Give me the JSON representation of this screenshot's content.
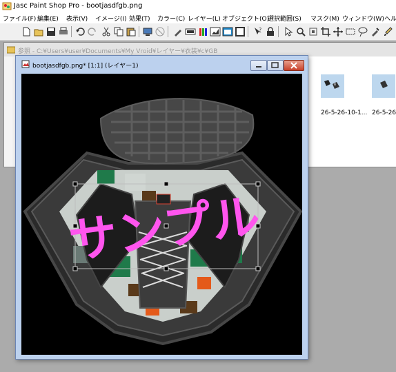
{
  "app": {
    "title": "Jasc Paint Shop Pro - bootjasdfgb.png"
  },
  "menu": [
    "ファイル(F)",
    "編集(E)",
    "表示(V)",
    "イメージ(I)",
    "効果(T)",
    "カラー(C)",
    "レイヤー(L)",
    "オブジェクト(O)",
    "選択範囲(S)",
    "マスク(M)",
    "ウィンドウ(W)",
    "ヘルプ"
  ],
  "toolbar_icons": [
    "new-icon",
    "open-icon",
    "save-icon",
    "print-icon",
    "undo-icon",
    "redo-icon",
    "cut-icon",
    "copy-icon",
    "paste-icon",
    "browse-icon",
    "screen-capture-icon",
    "brush-icon",
    "color-palette-icon",
    "histogram-icon",
    "layer-palette-icon",
    "overview-icon",
    "help-icon",
    "lock-icon",
    "arrow-tool-icon",
    "zoom-tool-icon",
    "deform-tool-icon",
    "crop-tool-icon",
    "move-tool-icon",
    "selection-tool-icon",
    "lasso-tool-icon",
    "dropper-tool-icon",
    "paint-brush-tool-icon"
  ],
  "back_window": {
    "title": "参照 - C:¥Users¥user¥Documents¥My Vroid¥レイヤー¥衣装¥c¥GB",
    "thumbnails": [
      {
        "caption": "26-5-26-10-1..."
      },
      {
        "caption": "26-5-26"
      }
    ]
  },
  "image_window": {
    "title": "bootjasdfgb.png* [1:1] (レイヤー1)",
    "watermark_text": "サンプル"
  },
  "colors": {
    "watermark": "#ff55ee",
    "window_title_bg": "#bcd1ee",
    "selection_handles": "#cccccc"
  }
}
